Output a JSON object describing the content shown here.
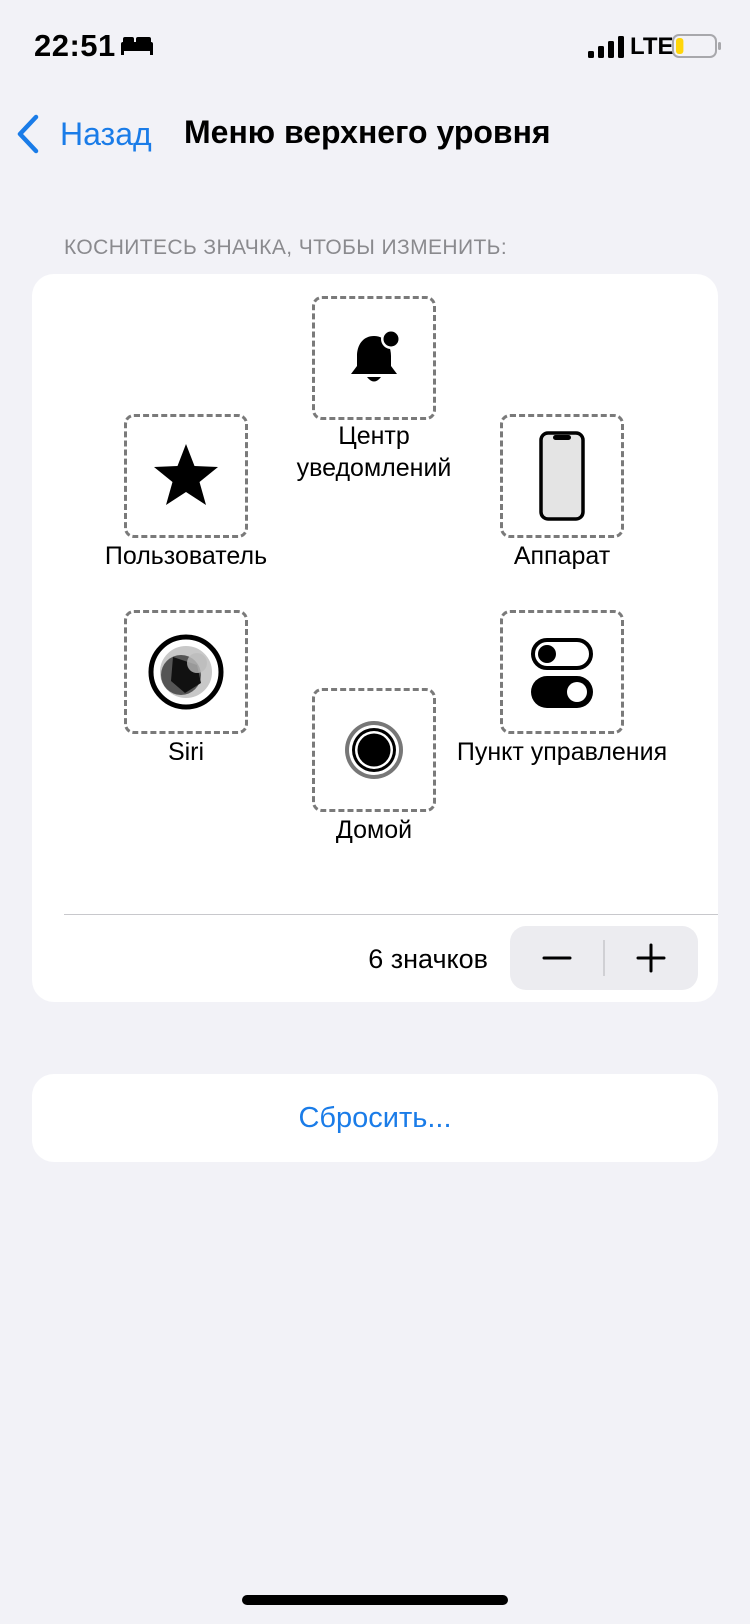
{
  "status_bar": {
    "time": "22:51",
    "network": "LTE",
    "icons": [
      "bed-icon",
      "signal-icon",
      "battery-icon"
    ],
    "battery_level_fraction": 0.2,
    "battery_color": "#ffd60a"
  },
  "nav": {
    "back_label": "Назад",
    "title": "Меню верхнего уровня"
  },
  "section": {
    "header": "КОСНИТЕСЬ ЗНАЧКА, ЧТОБЫ ИЗМЕНИТЬ:"
  },
  "menu": {
    "items": [
      {
        "label": "Центр уведомлений",
        "icon": "bell-icon"
      },
      {
        "label": "Пользователь",
        "icon": "star-icon"
      },
      {
        "label": "Аппарат",
        "icon": "phone-icon"
      },
      {
        "label": "Siri",
        "icon": "siri-icon"
      },
      {
        "label": "Пункт управления",
        "icon": "toggles-icon"
      },
      {
        "label": "Домой",
        "icon": "home-button-icon"
      }
    ],
    "count_label": "6 значков",
    "decrement_symbol": "−",
    "increment_symbol": "+"
  },
  "reset": {
    "label": "Сбросить..."
  },
  "colors": {
    "accent": "#1a7ce8",
    "background": "#f2f2f7",
    "card": "#ffffff",
    "secondary_text": "#8a8a8e"
  }
}
